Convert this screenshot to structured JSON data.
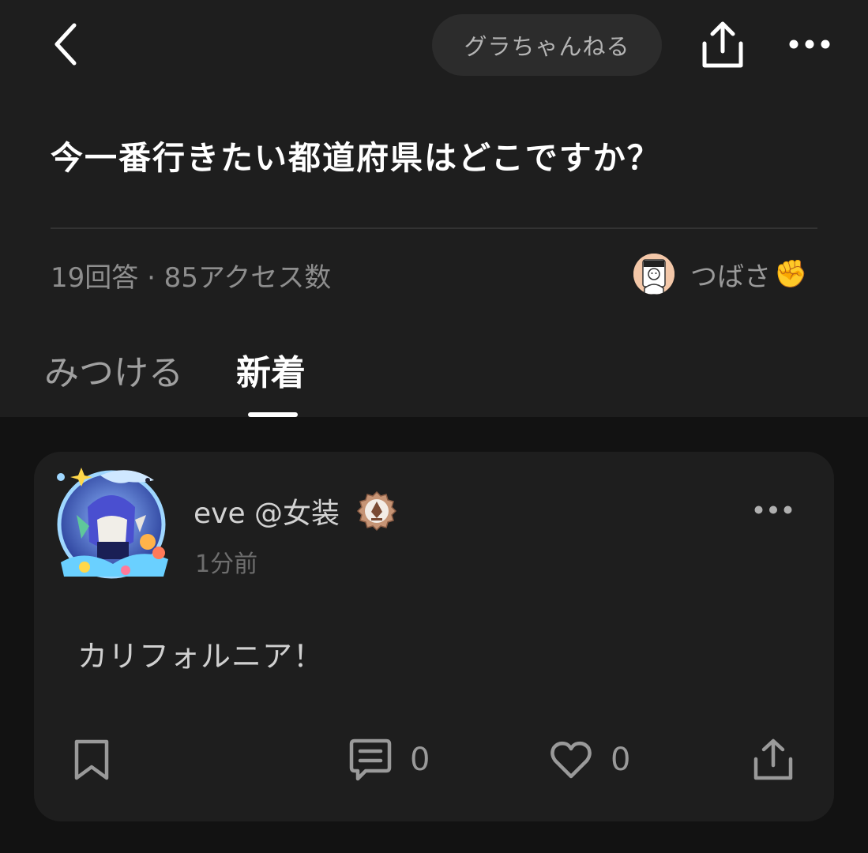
{
  "header": {
    "channel_name": "グラちゃんねる"
  },
  "question": {
    "title": "今一番行きたい都道府県はどこですか？",
    "stats": "19回答 · 85アクセス数",
    "author_name": "つばさ",
    "author_emoji": "✊"
  },
  "tabs": [
    {
      "label": "みつける",
      "active": false
    },
    {
      "label": "新着",
      "active": true
    }
  ],
  "post": {
    "username": "eve @女装",
    "time": "1分前",
    "body": "カリフォルニア！",
    "comment_count": "0",
    "like_count": "0"
  },
  "icons": {
    "back": "chevron-left-icon",
    "share": "share-icon",
    "more": "more-horizontal-icon",
    "bookmark": "bookmark-icon",
    "comment": "comment-icon",
    "like": "heart-icon",
    "badge": "pen-badge-icon"
  },
  "colors": {
    "background": "#121212",
    "surface": "#1e1e1e",
    "pill": "#2c2c2c",
    "text_primary": "#ffffff",
    "text_secondary": "#9a9a9a"
  }
}
